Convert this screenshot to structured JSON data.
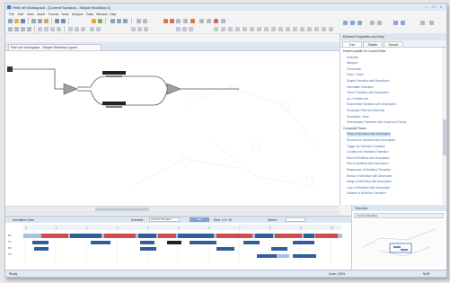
{
  "titlebar": {
    "title": "Petri net Workspace - [Current Scenario - Simple Workflow 4]",
    "controls": [
      "–",
      "□",
      "×"
    ]
  },
  "menu": [
    "File",
    "Edit",
    "View",
    "Insert",
    "Format",
    "Tools",
    "Analyze",
    "Data",
    "Window",
    "Help"
  ],
  "doc_tab": {
    "label": "Petri net Workspace - Simple Workflow 4.pnml"
  },
  "right_panel": {
    "title": "Element Properties and Help",
    "tabs": [
      "Tree",
      "Palette",
      "Search"
    ],
    "items": [
      {
        "label": "Element palette for Current Editor",
        "group": true
      },
      {
        "label": "Selection",
        "group": false
      },
      {
        "label": "Marquee",
        "group": false
      },
      {
        "label": "Connection",
        "group": false
      },
      {
        "label": "Place / Token",
        "group": false
      },
      {
        "label": "Simple Transition with Description",
        "group": false
      },
      {
        "label": "Immediate Transition",
        "group": false
      },
      {
        "label": "Timed Transition with Description",
        "group": false
      },
      {
        "label": "Arc / Inhibitor Arc",
        "group": false
      },
      {
        "label": "Exponential Transition with Description",
        "group": false
      },
      {
        "label": "Stochastic Petri Net Elements",
        "group": false
      },
      {
        "label": "Annotation / Note",
        "group": false
      },
      {
        "label": "Deterministic Transition with Guard and Priority",
        "group": false
      },
      {
        "label": "Composite Places",
        "group": true
      },
      {
        "label": "Place in Workflow with Description",
        "group": false
      },
      {
        "label": "Resource in Workflow with Description",
        "group": false
      },
      {
        "label": "Trigger for Workflow Transition",
        "group": false
      },
      {
        "label": "Condition for Workflow Transition",
        "group": false
      },
      {
        "label": "Start of Workflow with Description",
        "group": false
      },
      {
        "label": "End of Workflow with Description",
        "group": false
      },
      {
        "label": "Subprocess of Workflow Transition",
        "group": false
      },
      {
        "label": "Branch of Workflow with Description",
        "group": false
      },
      {
        "label": "Merge of Workflow with Description",
        "group": false
      },
      {
        "label": "Loop of Workflow with Description",
        "group": false
      },
      {
        "label": "Variable of Workflow Transition",
        "group": false
      }
    ]
  },
  "bottom_panel": {
    "title": "Simulation View",
    "scenario_label": "Scenario",
    "scenario_value": "Current Scenario",
    "start_button": "Start",
    "step_label": "Step: 1.0 / 10",
    "speed_label": "Speed",
    "row_labels": [
      "P1",
      "T1",
      "P2",
      "T2"
    ],
    "time_ticks": [
      "0",
      "1",
      "2",
      "3",
      "4",
      "5",
      "6",
      "7",
      "8",
      "9",
      "10"
    ]
  },
  "preview_panel": {
    "title": "Overview",
    "subtitle": "Current Workflow"
  },
  "statusbar": {
    "left": "Ready",
    "mid": "Zoom: 100%",
    "right": "NUM"
  },
  "colors": {
    "accent": "#4b79b5",
    "bar_blue": "#2f5f9b",
    "bar_red": "#d24a4a",
    "bar_light": "#a9c1de"
  }
}
